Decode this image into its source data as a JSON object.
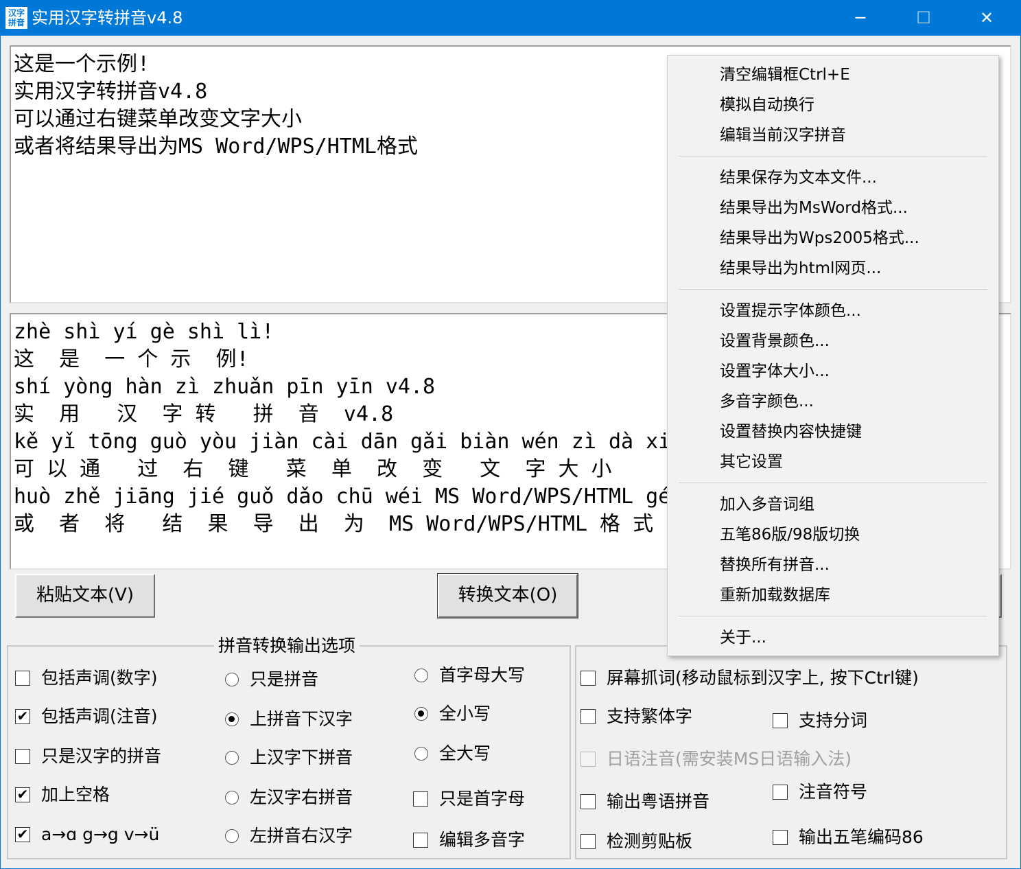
{
  "window": {
    "icon_text": "汉字\n拼音",
    "title": "实用汉字转拼音v4.8",
    "minimize": "─",
    "maximize": "☐",
    "close": "✕"
  },
  "input_lines": [
    "这是一个示例!",
    "实用汉字转拼音v4.8",
    "可以通过右键菜单改变文字大小",
    "或者将结果导出为MS Word/WPS/HTML格式"
  ],
  "output_lines": [
    "zhè shì yí gè shì lì!",
    "这  是  一 个 示  例!",
    "shí yòng hàn zì zhuǎn pīn yīn v4.8",
    "实  用   汉  字 转   拼  音  v4.8",
    "kě yǐ tōng guò yòu jiàn cài dān gǎi biàn wén zì dà xiǎo",
    "可 以 通   过  右  键   菜  单  改  变   文  字 大 小",
    "huò zhě jiāng jié guǒ dǎo chū wéi MS Word/WPS/HTML gé shì",
    "或  者  将   结  果  导  出  为  MS Word/WPS/HTML 格 式"
  ],
  "buttons": {
    "paste": "粘贴文本(V)",
    "convert": "转换文本(O)"
  },
  "left_group": {
    "title": "拼音转换输出选项",
    "col1": [
      {
        "label": "包括声调(数字)",
        "checked": false
      },
      {
        "label": "包括声调(注音)",
        "checked": true
      },
      {
        "label": "只是汉字的拼音",
        "checked": false
      },
      {
        "label": "加上空格",
        "checked": true
      },
      {
        "label": "a→ɑ g→g v→ü",
        "checked": true
      }
    ],
    "col2": [
      {
        "label": "只是拼音",
        "selected": false
      },
      {
        "label": "上拼音下汉字",
        "selected": true
      },
      {
        "label": "上汉字下拼音",
        "selected": false
      },
      {
        "label": "左汉字右拼音",
        "selected": false
      },
      {
        "label": "左拼音右汉字",
        "selected": false
      }
    ],
    "col3_radios": [
      {
        "label": "首字母大写",
        "selected": false
      },
      {
        "label": "全小写",
        "selected": true
      },
      {
        "label": "全大写",
        "selected": false
      }
    ],
    "col3_checks": [
      {
        "label": "只是首字母",
        "checked": false
      },
      {
        "label": "编辑多音字",
        "checked": false
      }
    ]
  },
  "right_group": {
    "screen_capture": {
      "label": "屏幕抓词(移动鼠标到汉字上, 按下Ctrl键)",
      "checked": false
    },
    "traditional": {
      "label": "支持繁体字",
      "checked": false
    },
    "segmentation": {
      "label": "支持分词",
      "checked": false
    },
    "japanese": {
      "label": "日语注音(需安装MS日语输入法)",
      "checked": false,
      "enabled": false
    },
    "cantonese": {
      "label": "输出粤语拼音",
      "checked": false
    },
    "zhuyin": {
      "label": "注音符号",
      "checked": false
    },
    "clipboard": {
      "label": "检测剪贴板",
      "checked": false
    },
    "wubi": {
      "label": "输出五笔编码86",
      "checked": false
    }
  },
  "context_menu": {
    "groups": [
      [
        "清空编辑框Ctrl+E",
        "模拟自动换行",
        "编辑当前汉字拼音"
      ],
      [
        "结果保存为文本文件...",
        "结果导出为MsWord格式...",
        "结果导出为Wps2005格式...",
        "结果导出为html网页..."
      ],
      [
        "设置提示字体颜色...",
        "设置背景颜色...",
        "设置字体大小...",
        "多音字颜色...",
        "设置替换内容快捷键",
        "其它设置"
      ],
      [
        "加入多音词组",
        "五笔86版/98版切换",
        "替换所有拼音...",
        "重新加载数据库"
      ],
      [
        "关于..."
      ]
    ]
  }
}
